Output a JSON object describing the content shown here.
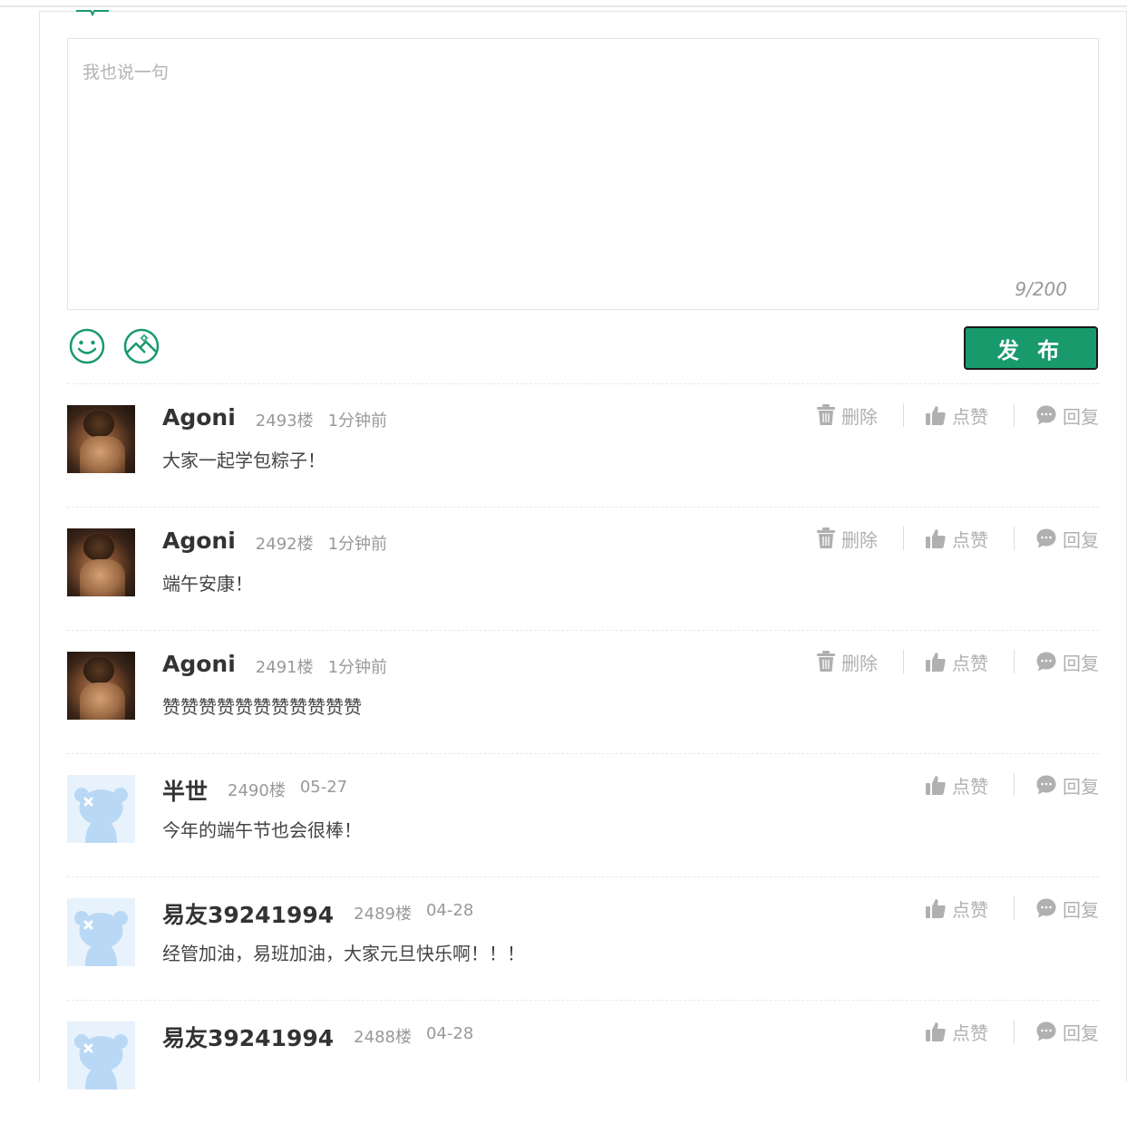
{
  "editor": {
    "placeholder": "我也说一句",
    "counter": "9/200"
  },
  "toolbar": {
    "emoji_icon": "smiley-icon",
    "image_icon": "image-icon",
    "publish_label": "发 布"
  },
  "colors": {
    "accent": "#199a6d",
    "muted": "#b0b0b0"
  },
  "actions": {
    "delete_label": "删除",
    "like_label": "点赞",
    "reply_label": "回复"
  },
  "comments": [
    {
      "username": "Agoni",
      "floor": "2493楼",
      "time": "1分钟前",
      "content": "大家一起学包粽子！",
      "deletable": true,
      "avatar": "photo"
    },
    {
      "username": "Agoni",
      "floor": "2492楼",
      "time": "1分钟前",
      "content": "端午安康！",
      "deletable": true,
      "avatar": "photo"
    },
    {
      "username": "Agoni",
      "floor": "2491楼",
      "time": "1分钟前",
      "content": "赞赞赞赞赞赞赞赞赞赞赞",
      "deletable": true,
      "avatar": "photo"
    },
    {
      "username": "半世",
      "floor": "2490楼",
      "time": "05-27",
      "content": "今年的端午节也会很棒！",
      "deletable": false,
      "avatar": "bear"
    },
    {
      "username": "易友39241994",
      "floor": "2489楼",
      "time": "04-28",
      "content": "经管加油，易班加油，大家元旦快乐啊！！！",
      "deletable": false,
      "avatar": "bear"
    },
    {
      "username": "易友39241994",
      "floor": "2488楼",
      "time": "04-28",
      "content": "",
      "deletable": false,
      "avatar": "bear"
    }
  ]
}
